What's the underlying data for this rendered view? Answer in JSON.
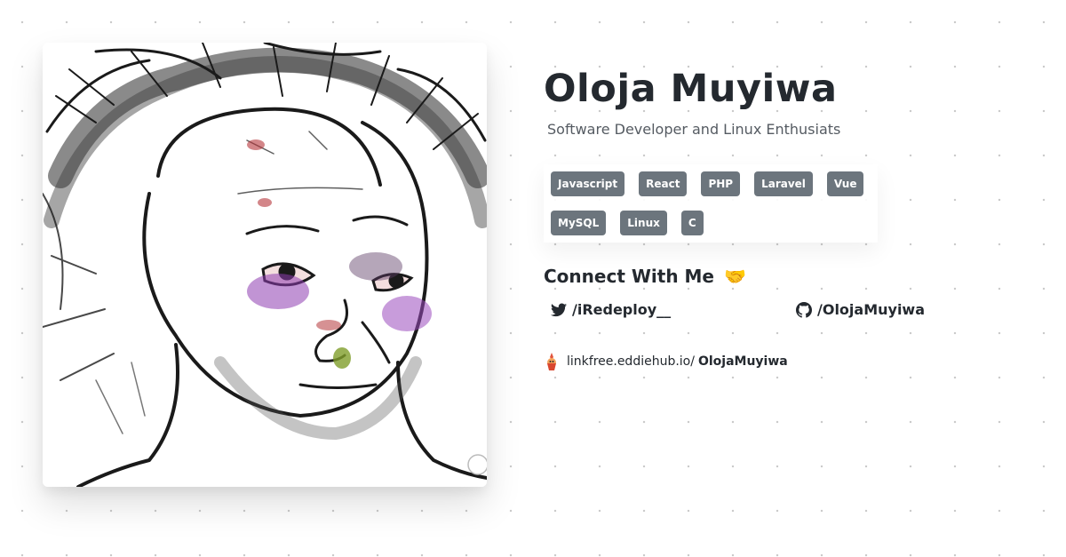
{
  "profile": {
    "name": "Oloja Muyiwa",
    "tagline": "Software Developer and Linux Enthusiats"
  },
  "skills": [
    "Javascript",
    "React",
    "PHP",
    "Laravel",
    "Vue",
    "MySQL",
    "Linux",
    "C"
  ],
  "connect": {
    "title": "Connect With Me",
    "emoji": "🤝",
    "twitter": {
      "icon": "twitter-bird-icon",
      "handle": "/iRedeploy__"
    },
    "github": {
      "icon": "github-octocat-icon",
      "handle": "/OlojaMuyiwa"
    }
  },
  "linkfree": {
    "icon": "linkfree-logo-icon",
    "domain": "linkfree.eddiehub.io/",
    "user": "OlojaMuyiwa"
  },
  "colors": {
    "badge_bg": "#6c757d",
    "text": "#24292f",
    "muted": "#555b62",
    "emoji_yellow": "#f1b13c"
  }
}
